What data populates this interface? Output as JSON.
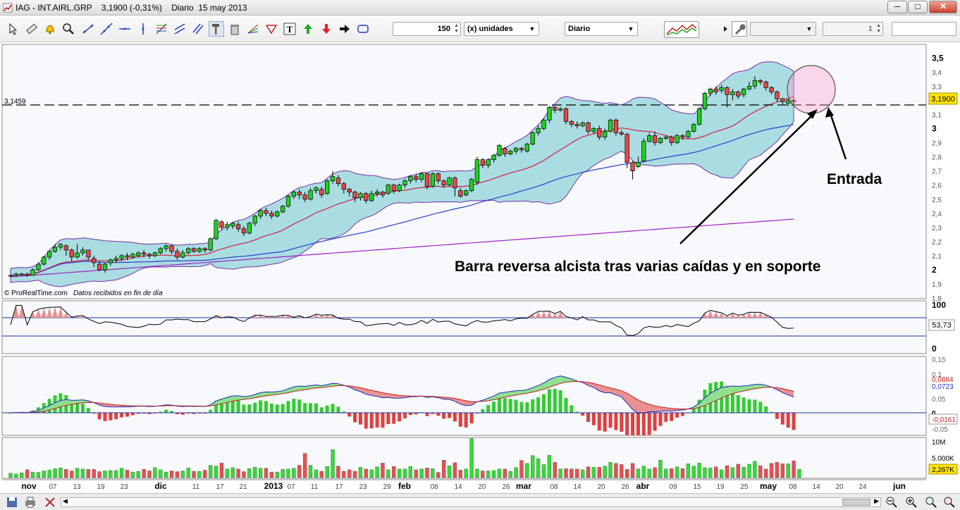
{
  "window": {
    "title": "IAG - INT.AIRL.GRP    3,1900 (-0,31%)    Diario  15 may 2013",
    "minimize": "─",
    "maximize": "□",
    "close": "✕"
  },
  "toolbar": {
    "units_value": "150",
    "units_label": "(x) unidades",
    "period": "Diario",
    "right_spin_value": "1",
    "icons": [
      "pointer-icon",
      "ruler-icon",
      "alarm-bell-icon",
      "zoom-icon",
      "trendline-icon",
      "line-icon",
      "horizontal-line-icon",
      "vertical-line-icon",
      "fibonacci-icon",
      "channel-icon",
      "parallel-lines-icon",
      "hammer-icon",
      "trash-icon",
      "fan-icon",
      "triangle-icon",
      "text-icon",
      "arrow-up-icon",
      "arrow-down-icon",
      "arrow-right-icon",
      "rectangle-icon",
      "indicators-icon",
      "wrench-icon"
    ]
  },
  "chart": {
    "reference_line_label": "3,1459",
    "copyright": "© ProRealTime.com",
    "data_note": "Datos recibidos en fin de día",
    "last_price_badge": "3,1900",
    "price_axis": [
      "3,5",
      "3,4",
      "3,3",
      "3,2",
      "3,1",
      "3",
      "2,9",
      "2,8",
      "2,7",
      "2,6",
      "2,5",
      "2,4",
      "2,3",
      "2,2",
      "2,1",
      "2",
      "1,9",
      "1,8"
    ],
    "annotation_entry": "Entrada",
    "annotation_reversal": "Barra reversa alcista tras varias caídas y en soporte",
    "accent_color": "#d9006c"
  },
  "rsi": {
    "axis_top": "100",
    "axis_bottom": "0",
    "value_badge": "53,73"
  },
  "macd": {
    "axis": [
      "0,15",
      "0,1",
      "0,05",
      "0",
      "-0,05"
    ],
    "badge_signal": "0,0884",
    "badge_macd": "0,0723",
    "badge_hist": "-0,0161"
  },
  "volume": {
    "axis": [
      "10M",
      "5.000K"
    ],
    "value_badge": "2,267K"
  },
  "dates": [
    {
      "t": "nov",
      "b": true
    },
    {
      "t": "07",
      "b": false
    },
    {
      "t": "13",
      "b": false
    },
    {
      "t": "19",
      "b": false
    },
    {
      "t": "23",
      "b": false
    },
    {
      "t": "dic",
      "b": true
    },
    {
      "t": "11",
      "b": false
    },
    {
      "t": "17",
      "b": false
    },
    {
      "t": "21",
      "b": false
    },
    {
      "t": "2013",
      "b": true
    },
    {
      "t": "07",
      "b": false
    },
    {
      "t": "11",
      "b": false
    },
    {
      "t": "17",
      "b": false
    },
    {
      "t": "23",
      "b": false
    },
    {
      "t": "29",
      "b": false
    },
    {
      "t": "feb",
      "b": true
    },
    {
      "t": "08",
      "b": false
    },
    {
      "t": "14",
      "b": false
    },
    {
      "t": "20",
      "b": false
    },
    {
      "t": "26",
      "b": false
    },
    {
      "t": "mar",
      "b": true
    },
    {
      "t": "08",
      "b": false
    },
    {
      "t": "14",
      "b": false
    },
    {
      "t": "20",
      "b": false
    },
    {
      "t": "26",
      "b": false
    },
    {
      "t": "abr",
      "b": true
    },
    {
      "t": "09",
      "b": false
    },
    {
      "t": "15",
      "b": false
    },
    {
      "t": "19",
      "b": false
    },
    {
      "t": "25",
      "b": false
    },
    {
      "t": "may",
      "b": true
    },
    {
      "t": "08",
      "b": false
    },
    {
      "t": "14",
      "b": false
    },
    {
      "t": "20",
      "b": false
    },
    {
      "t": "24",
      "b": false
    },
    {
      "t": "jun",
      "b": true
    }
  ],
  "candles": [
    [
      1.96,
      1.96,
      1.95,
      1.97
    ],
    [
      1.96,
      1.97,
      1.95,
      1.98
    ],
    [
      1.97,
      1.97,
      1.96,
      1.98
    ],
    [
      1.97,
      1.96,
      1.95,
      1.98
    ],
    [
      1.96,
      2.0,
      1.96,
      2.01
    ],
    [
      2.0,
      2.04,
      1.99,
      2.05
    ],
    [
      2.04,
      2.09,
      2.03,
      2.1
    ],
    [
      2.09,
      2.13,
      2.07,
      2.14
    ],
    [
      2.13,
      2.16,
      2.12,
      2.18
    ],
    [
      2.16,
      2.18,
      2.14,
      2.19
    ],
    [
      2.17,
      2.14,
      2.1,
      2.18
    ],
    [
      2.14,
      2.09,
      2.06,
      2.15
    ],
    [
      2.09,
      2.12,
      2.08,
      2.18
    ],
    [
      2.12,
      2.14,
      2.1,
      2.16
    ],
    [
      2.14,
      2.09,
      2.07,
      2.14
    ],
    [
      2.08,
      2.05,
      2.02,
      2.1
    ],
    [
      2.04,
      2.0,
      1.99,
      2.06
    ],
    [
      2.0,
      2.04,
      1.98,
      2.05
    ],
    [
      2.05,
      2.07,
      2.03,
      2.08
    ],
    [
      2.07,
      2.08,
      2.05,
      2.1
    ],
    [
      2.08,
      2.1,
      2.06,
      2.11
    ],
    [
      2.1,
      2.09,
      2.07,
      2.12
    ],
    [
      2.09,
      2.11,
      2.08,
      2.12
    ],
    [
      2.1,
      2.12,
      2.09,
      2.13
    ],
    [
      2.12,
      2.11,
      2.09,
      2.14
    ],
    [
      2.11,
      2.1,
      2.08,
      2.12
    ],
    [
      2.1,
      2.12,
      2.09,
      2.13
    ],
    [
      2.12,
      2.15,
      2.11,
      2.16
    ],
    [
      2.15,
      2.17,
      2.13,
      2.18
    ],
    [
      2.17,
      2.13,
      2.11,
      2.18
    ],
    [
      2.13,
      2.09,
      2.07,
      2.15
    ],
    [
      2.09,
      2.12,
      2.08,
      2.14
    ],
    [
      2.12,
      2.15,
      2.11,
      2.16
    ],
    [
      2.15,
      2.13,
      2.12,
      2.16
    ],
    [
      2.13,
      2.15,
      2.12,
      2.16
    ],
    [
      2.15,
      2.14,
      2.12,
      2.16
    ],
    [
      2.14,
      2.22,
      2.13,
      2.23
    ],
    [
      2.22,
      2.35,
      2.21,
      2.36
    ],
    [
      2.34,
      2.3,
      2.28,
      2.35
    ],
    [
      2.3,
      2.32,
      2.28,
      2.34
    ],
    [
      2.31,
      2.33,
      2.29,
      2.34
    ],
    [
      2.32,
      2.29,
      2.27,
      2.34
    ],
    [
      2.29,
      2.26,
      2.24,
      2.31
    ],
    [
      2.26,
      2.33,
      2.25,
      2.34
    ],
    [
      2.33,
      2.38,
      2.31,
      2.39
    ],
    [
      2.38,
      2.42,
      2.36,
      2.43
    ],
    [
      2.42,
      2.4,
      2.38,
      2.44
    ],
    [
      2.4,
      2.38,
      2.36,
      2.42
    ],
    [
      2.38,
      2.41,
      2.37,
      2.42
    ],
    [
      2.41,
      2.45,
      2.4,
      2.46
    ],
    [
      2.45,
      2.52,
      2.44,
      2.53
    ],
    [
      2.52,
      2.55,
      2.5,
      2.56
    ],
    [
      2.55,
      2.53,
      2.5,
      2.57
    ],
    [
      2.53,
      2.5,
      2.48,
      2.55
    ],
    [
      2.5,
      2.56,
      2.49,
      2.58
    ],
    [
      2.56,
      2.58,
      2.54,
      2.59
    ],
    [
      2.57,
      2.53,
      2.51,
      2.59
    ],
    [
      2.54,
      2.63,
      2.53,
      2.64
    ],
    [
      2.63,
      2.66,
      2.61,
      2.7
    ],
    [
      2.65,
      2.61,
      2.59,
      2.67
    ],
    [
      2.61,
      2.57,
      2.54,
      2.62
    ],
    [
      2.57,
      2.55,
      2.52,
      2.58
    ],
    [
      2.55,
      2.51,
      2.48,
      2.56
    ],
    [
      2.51,
      2.54,
      2.49,
      2.55
    ],
    [
      2.54,
      2.49,
      2.47,
      2.55
    ],
    [
      2.49,
      2.54,
      2.48,
      2.56
    ],
    [
      2.54,
      2.55,
      2.52,
      2.57
    ],
    [
      2.55,
      2.53,
      2.51,
      2.56
    ],
    [
      2.54,
      2.6,
      2.53,
      2.61
    ],
    [
      2.6,
      2.56,
      2.54,
      2.61
    ],
    [
      2.56,
      2.6,
      2.55,
      2.61
    ],
    [
      2.6,
      2.63,
      2.58,
      2.64
    ],
    [
      2.63,
      2.66,
      2.61,
      2.67
    ],
    [
      2.66,
      2.64,
      2.62,
      2.68
    ],
    [
      2.64,
      2.68,
      2.62,
      2.69
    ],
    [
      2.68,
      2.59,
      2.57,
      2.69
    ],
    [
      2.59,
      2.68,
      2.58,
      2.69
    ],
    [
      2.68,
      2.63,
      2.61,
      2.69
    ],
    [
      2.63,
      2.6,
      2.58,
      2.64
    ],
    [
      2.6,
      2.65,
      2.59,
      2.66
    ],
    [
      2.65,
      2.58,
      2.52,
      2.66
    ],
    [
      2.56,
      2.52,
      2.51,
      2.58
    ],
    [
      2.53,
      2.56,
      2.52,
      2.57
    ],
    [
      2.56,
      2.64,
      2.55,
      2.65
    ],
    [
      2.62,
      2.78,
      2.6,
      2.8
    ],
    [
      2.78,
      2.74,
      2.72,
      2.79
    ],
    [
      2.74,
      2.78,
      2.72,
      2.79
    ],
    [
      2.78,
      2.81,
      2.76,
      2.82
    ],
    [
      2.81,
      2.88,
      2.8,
      2.89
    ],
    [
      2.86,
      2.82,
      2.8,
      2.87
    ],
    [
      2.82,
      2.84,
      2.81,
      2.85
    ],
    [
      2.84,
      2.86,
      2.82,
      2.87
    ],
    [
      2.86,
      2.85,
      2.83,
      2.87
    ],
    [
      2.84,
      2.89,
      2.83,
      2.9
    ],
    [
      2.89,
      2.97,
      2.88,
      2.98
    ],
    [
      2.97,
      3.0,
      2.95,
      3.02
    ],
    [
      3.0,
      3.06,
      2.99,
      3.07
    ],
    [
      3.06,
      3.15,
      3.04,
      3.16
    ],
    [
      3.15,
      3.13,
      3.11,
      3.16
    ],
    [
      3.13,
      3.14,
      3.12,
      3.15
    ],
    [
      3.14,
      3.05,
      3.03,
      3.15
    ],
    [
      3.05,
      3.03,
      3.01,
      3.06
    ],
    [
      3.03,
      3.02,
      3.0,
      3.05
    ],
    [
      3.02,
      3.04,
      3.01,
      3.05
    ],
    [
      3.04,
      2.98,
      2.96,
      3.05
    ],
    [
      2.98,
      3.0,
      2.96,
      3.01
    ],
    [
      3.0,
      2.94,
      2.92,
      3.02
    ],
    [
      2.94,
      2.98,
      2.92,
      3.0
    ],
    [
      2.98,
      3.06,
      2.97,
      3.07
    ],
    [
      3.06,
      2.97,
      2.95,
      3.07
    ],
    [
      2.97,
      2.96,
      2.95,
      2.99
    ],
    [
      2.96,
      2.76,
      2.72,
      2.97
    ],
    [
      2.76,
      2.7,
      2.64,
      2.77
    ],
    [
      2.73,
      2.76,
      2.72,
      2.8
    ],
    [
      2.77,
      2.91,
      2.76,
      2.93
    ],
    [
      2.91,
      2.95,
      2.9,
      2.97
    ],
    [
      2.95,
      2.9,
      2.88,
      2.98
    ],
    [
      2.9,
      2.93,
      2.89,
      2.94
    ],
    [
      2.93,
      2.94,
      2.92,
      2.95
    ],
    [
      2.94,
      2.9,
      2.88,
      2.95
    ],
    [
      2.9,
      2.95,
      2.89,
      2.96
    ],
    [
      2.95,
      2.94,
      2.92,
      2.96
    ],
    [
      2.94,
      2.98,
      2.93,
      2.99
    ],
    [
      2.98,
      3.03,
      2.97,
      3.04
    ],
    [
      3.03,
      3.14,
      3.02,
      3.15
    ],
    [
      3.14,
      3.25,
      3.13,
      3.26
    ],
    [
      3.25,
      3.28,
      3.23,
      3.29
    ],
    [
      3.28,
      3.26,
      3.24,
      3.3
    ],
    [
      3.27,
      3.29,
      3.25,
      3.31
    ],
    [
      3.29,
      3.24,
      3.15,
      3.3
    ],
    [
      3.24,
      3.26,
      3.2,
      3.28
    ],
    [
      3.26,
      3.23,
      3.21,
      3.27
    ],
    [
      3.24,
      3.28,
      3.22,
      3.29
    ],
    [
      3.28,
      3.3,
      3.27,
      3.33
    ],
    [
      3.3,
      3.34,
      3.28,
      3.37
    ],
    [
      3.34,
      3.33,
      3.31,
      3.35
    ],
    [
      3.33,
      3.29,
      3.27,
      3.34
    ],
    [
      3.29,
      3.26,
      3.24,
      3.3
    ],
    [
      3.26,
      3.21,
      3.19,
      3.27
    ],
    [
      3.21,
      3.19,
      3.17,
      3.22
    ],
    [
      3.18,
      3.2,
      3.16,
      3.21
    ],
    [
      3.2,
      3.19,
      3.17,
      3.21
    ]
  ],
  "volumes": [
    1.2,
    1.0,
    1.3,
    2.1,
    1.5,
    1.4,
    1.8,
    2.0,
    2.4,
    2.6,
    2.2,
    1.8,
    2.5,
    2.3,
    2.2,
    2.2,
    1.6,
    1.8,
    1.9,
    1.9,
    2.5,
    2.0,
    1.5,
    1.7,
    2.2,
    1.8,
    2.7,
    2.1,
    1.5,
    1.8,
    1.6,
    1.8,
    2.6,
    1.7,
    1.7,
    2.0,
    3.3,
    3.1,
    3.9,
    2.3,
    2.7,
    2.3,
    1.6,
    2.4,
    2.8,
    2.5,
    2.5,
    1.5,
    1.5,
    2.2,
    2.3,
    2.5,
    3.3,
    6.5,
    3.3,
    2.1,
    1.7,
    3.0,
    7.5,
    3.1,
    1.7,
    2.1,
    1.7,
    2.8,
    2.3,
    2.1,
    2.9,
    3.9,
    2.1,
    3.0,
    2.3,
    2.3,
    3.0,
    2.1,
    2.3,
    2.6,
    2.4,
    1.4,
    4.7,
    3.2,
    4.0,
    2.0,
    2.3,
    10.5,
    2.3,
    1.8,
    1.8,
    1.9,
    2.3,
    2.3,
    1.7,
    2.7,
    4.6,
    3.8,
    5.9,
    5.1,
    3.5,
    6.0,
    4.1,
    2.3,
    2.4,
    2.3,
    2.3,
    2.1,
    2.9,
    2.8,
    2.8,
    3.1,
    4.1,
    3.8,
    3.5,
    2.2,
    3.8,
    2.3,
    3.1,
    2.3,
    2.7,
    4.7,
    2.3,
    2.4,
    2.9,
    2.4,
    3.7,
    3.1,
    3.9,
    2.7,
    2.6,
    2.9,
    2.1,
    3.2,
    2.7,
    3.6,
    2.8,
    3.6,
    4.4,
    3.2,
    2.3,
    3.8,
    4.1,
    3.7,
    3.7,
    4.5,
    2.2
  ]
}
